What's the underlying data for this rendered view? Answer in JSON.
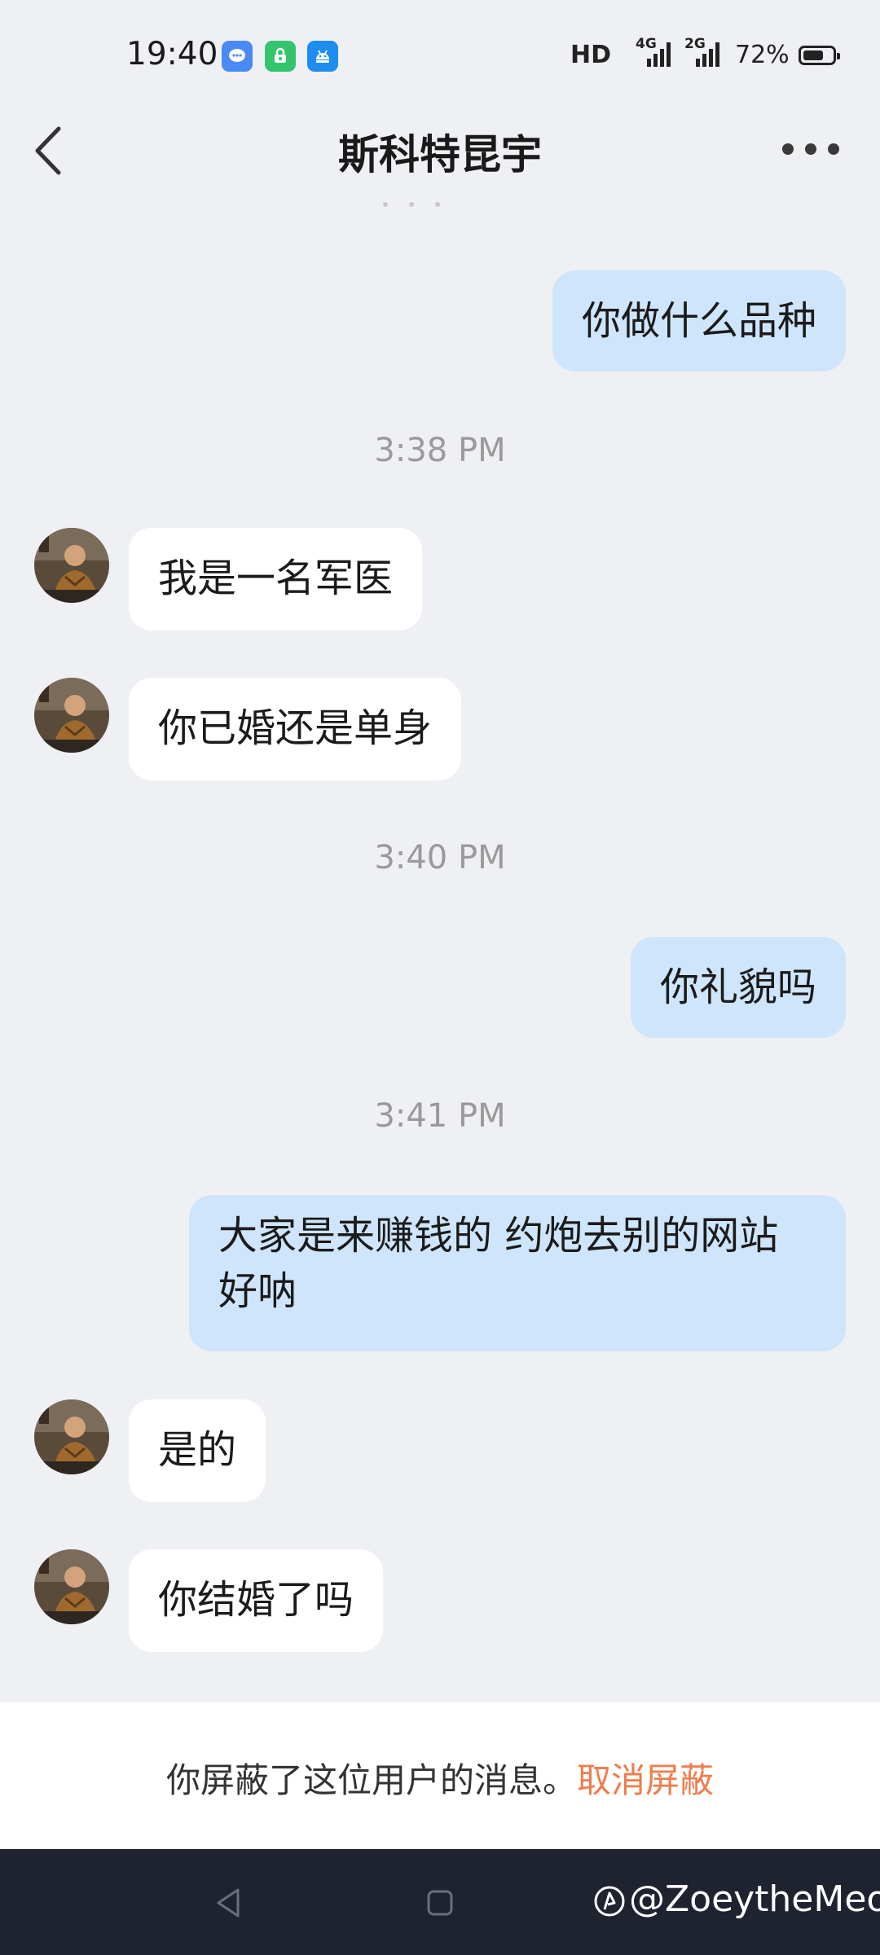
{
  "status_bar": {
    "time": "19:40",
    "hd_label": "HD",
    "net1": "4G",
    "net2": "2G",
    "battery_pct": "72%",
    "battery_level": 0.72,
    "app_icons": [
      "chat-bubble-icon",
      "green-lock-app-icon",
      "android-icon"
    ]
  },
  "header": {
    "title": "斯科特昆宇"
  },
  "messages": [
    {
      "type": "out",
      "text": "你做什么品种"
    },
    {
      "type": "time",
      "text": "3:38 PM"
    },
    {
      "type": "in",
      "text": "我是一名军医"
    },
    {
      "type": "in",
      "text": "你已婚还是单身"
    },
    {
      "type": "time",
      "text": "3:40 PM"
    },
    {
      "type": "out",
      "text": "你礼貌吗"
    },
    {
      "type": "time",
      "text": "3:41 PM"
    },
    {
      "type": "out",
      "text": "大家是来赚钱的 约炮去别的网站好呐"
    },
    {
      "type": "in",
      "text": "是的"
    },
    {
      "type": "in",
      "text": "你结婚了吗"
    }
  ],
  "blocked_bar": {
    "text": "你屏蔽了这位用户的消息。",
    "action": "取消屏蔽"
  },
  "watermark": "@ZoeytheMeow",
  "colors": {
    "background": "#eff0f4",
    "outgoing_bubble": "#cfe5fc",
    "incoming_bubble": "#ffffff",
    "accent": "#ef7d4c",
    "nav_bar": "#1f2330"
  }
}
